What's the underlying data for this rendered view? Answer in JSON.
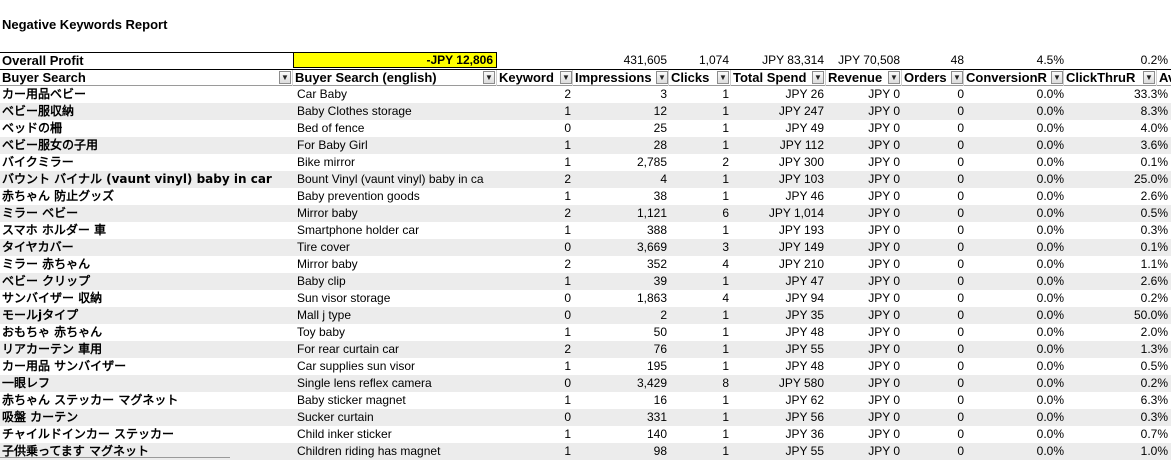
{
  "report": {
    "title": "Negative Keywords Report"
  },
  "overall": {
    "label": "Overall Profit",
    "profit": "-JPY 12,806",
    "impressions": "431,605",
    "clicks": "1,074",
    "spend": "JPY 83,314",
    "revenue": "JPY 70,508",
    "orders": "48",
    "conversion": "4.5%",
    "ctr": "0.2%"
  },
  "headers": {
    "buyer_search": "Buyer Search",
    "buyer_search_english": "Buyer Search (english)",
    "keyword": "Keyword",
    "impressions": "Impressions",
    "clicks": "Clicks",
    "total_spend": "Total Spend",
    "revenue": "Revenue",
    "orders": "Orders",
    "conversion": "ConversionR",
    "ctr": "ClickThruR",
    "next": "Av"
  },
  "icons": {
    "filter": "dropdown-arrow-icon",
    "active_filter": "filter-funnel-icon"
  },
  "rows": [
    [
      "カー用品ベビー",
      "Car Baby",
      "2",
      "3",
      "1",
      "JPY 26",
      "JPY 0",
      "0",
      "0.0%",
      "33.3%"
    ],
    [
      "ベビー服収納",
      "Baby Clothes storage",
      "1",
      "12",
      "1",
      "JPY 247",
      "JPY 0",
      "0",
      "0.0%",
      "8.3%"
    ],
    [
      "ベッドの柵",
      "Bed of fence",
      "0",
      "25",
      "1",
      "JPY 49",
      "JPY 0",
      "0",
      "0.0%",
      "4.0%"
    ],
    [
      "ベビー服女の子用",
      "For Baby Girl",
      "1",
      "28",
      "1",
      "JPY 112",
      "JPY 0",
      "0",
      "0.0%",
      "3.6%"
    ],
    [
      "バイクミラー",
      "Bike mirror",
      "1",
      "2,785",
      "2",
      "JPY 300",
      "JPY 0",
      "0",
      "0.0%",
      "0.1%"
    ],
    [
      "バウント バイナル (vaunt vinyl) baby in car",
      "Bount Vinyl (vaunt vinyl) baby in ca",
      "2",
      "4",
      "1",
      "JPY 103",
      "JPY 0",
      "0",
      "0.0%",
      "25.0%"
    ],
    [
      "赤ちゃん 防止グッズ",
      "Baby prevention goods",
      "1",
      "38",
      "1",
      "JPY 46",
      "JPY 0",
      "0",
      "0.0%",
      "2.6%"
    ],
    [
      "ミラー ベビー",
      "Mirror baby",
      "2",
      "1,121",
      "6",
      "JPY 1,014",
      "JPY 0",
      "0",
      "0.0%",
      "0.5%"
    ],
    [
      "スマホ ホルダー 車",
      "Smartphone holder car",
      "1",
      "388",
      "1",
      "JPY 193",
      "JPY 0",
      "0",
      "0.0%",
      "0.3%"
    ],
    [
      "タイヤカバー",
      "Tire cover",
      "0",
      "3,669",
      "3",
      "JPY 149",
      "JPY 0",
      "0",
      "0.0%",
      "0.1%"
    ],
    [
      "ミラー 赤ちゃん",
      "Mirror baby",
      "2",
      "352",
      "4",
      "JPY 210",
      "JPY 0",
      "0",
      "0.0%",
      "1.1%"
    ],
    [
      "ベビー クリップ",
      "Baby clip",
      "1",
      "39",
      "1",
      "JPY 47",
      "JPY 0",
      "0",
      "0.0%",
      "2.6%"
    ],
    [
      "サンバイザー 収納",
      "Sun visor storage",
      "0",
      "1,863",
      "4",
      "JPY 94",
      "JPY 0",
      "0",
      "0.0%",
      "0.2%"
    ],
    [
      "モールjタイプ",
      "Mall j type",
      "0",
      "2",
      "1",
      "JPY 35",
      "JPY 0",
      "0",
      "0.0%",
      "50.0%"
    ],
    [
      "おもちゃ 赤ちゃん",
      "Toy baby",
      "1",
      "50",
      "1",
      "JPY 48",
      "JPY 0",
      "0",
      "0.0%",
      "2.0%"
    ],
    [
      "リアカーテン 車用",
      "For rear curtain car",
      "2",
      "76",
      "1",
      "JPY 55",
      "JPY 0",
      "0",
      "0.0%",
      "1.3%"
    ],
    [
      "カー用品 サンバイザー",
      "Car supplies sun visor",
      "1",
      "195",
      "1",
      "JPY 48",
      "JPY 0",
      "0",
      "0.0%",
      "0.5%"
    ],
    [
      "一眼レフ",
      "Single lens reflex camera",
      "0",
      "3,429",
      "8",
      "JPY 580",
      "JPY 0",
      "0",
      "0.0%",
      "0.2%"
    ],
    [
      "赤ちゃん ステッカー マグネット",
      "Baby sticker magnet",
      "1",
      "16",
      "1",
      "JPY 62",
      "JPY 0",
      "0",
      "0.0%",
      "6.3%"
    ],
    [
      "吸盤 カーテン",
      "Sucker curtain",
      "0",
      "331",
      "1",
      "JPY 56",
      "JPY 0",
      "0",
      "0.0%",
      "0.3%"
    ],
    [
      "チャイルドインカー ステッカー",
      "Child inker sticker",
      "1",
      "140",
      "1",
      "JPY 36",
      "JPY 0",
      "0",
      "0.0%",
      "0.7%"
    ],
    [
      "子供乗ってます マグネット",
      "Children riding has magnet",
      "1",
      "98",
      "1",
      "JPY 55",
      "JPY 0",
      "0",
      "0.0%",
      "1.0%"
    ]
  ]
}
